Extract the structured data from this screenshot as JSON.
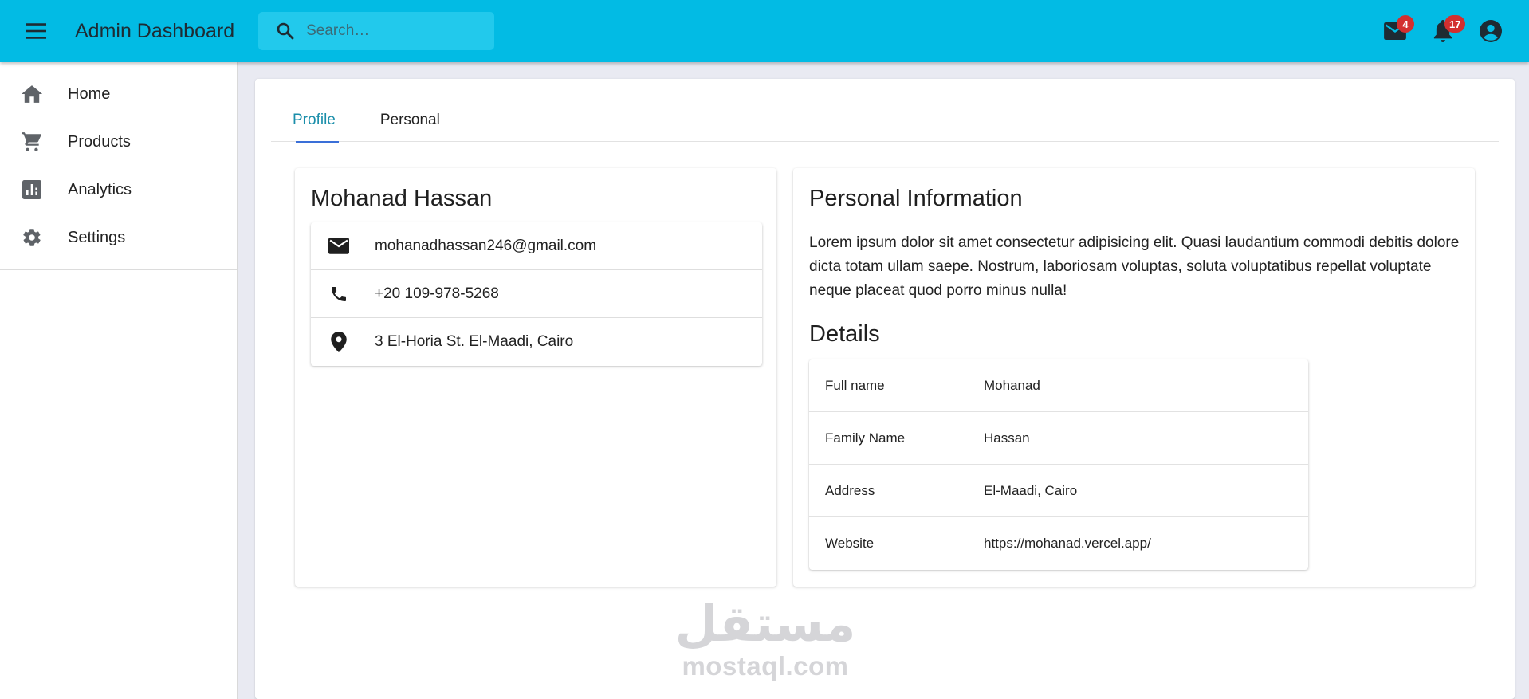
{
  "app": {
    "title": "Admin Dashboard"
  },
  "search": {
    "placeholder": "Search…"
  },
  "header": {
    "mail_badge": "4",
    "notifications_badge": "17"
  },
  "sidebar": {
    "items": [
      {
        "label": "Home",
        "icon": "home-icon"
      },
      {
        "label": "Products",
        "icon": "cart-icon"
      },
      {
        "label": "Analytics",
        "icon": "analytics-icon"
      },
      {
        "label": "Settings",
        "icon": "gear-icon"
      }
    ]
  },
  "tabs": [
    {
      "label": "Profile",
      "active": true
    },
    {
      "label": "Personal",
      "active": false
    }
  ],
  "profile": {
    "name": "Mohanad Hassan",
    "email": "mohanadhassan246@gmail.com",
    "phone": "+20 109-978-5268",
    "address": "3 El-Horia St. El-Maadi, Cairo"
  },
  "personal": {
    "title": "Personal Information",
    "about": "Lorem ipsum dolor sit amet consectetur adipisicing elit. Quasi laudantium commodi debitis dolore dicta totam ullam saepe. Nostrum, laboriosam voluptas, soluta voluptatibus repellat voluptate neque placeat quod porro minus nulla!",
    "details_title": "Details",
    "details": [
      {
        "key": "Full name",
        "value": "Mohanad"
      },
      {
        "key": "Family Name",
        "value": "Hassan"
      },
      {
        "key": "Address",
        "value": "El-Maadi, Cairo"
      },
      {
        "key": "Website",
        "value": "https://mohanad.vercel.app/"
      }
    ]
  },
  "watermark": {
    "arabic": "مستقل",
    "latin": "mostaql.com"
  },
  "colors": {
    "appbar": "#02bbe4",
    "active_tab": "#1a8eaa",
    "badge": "#d32f2f"
  }
}
